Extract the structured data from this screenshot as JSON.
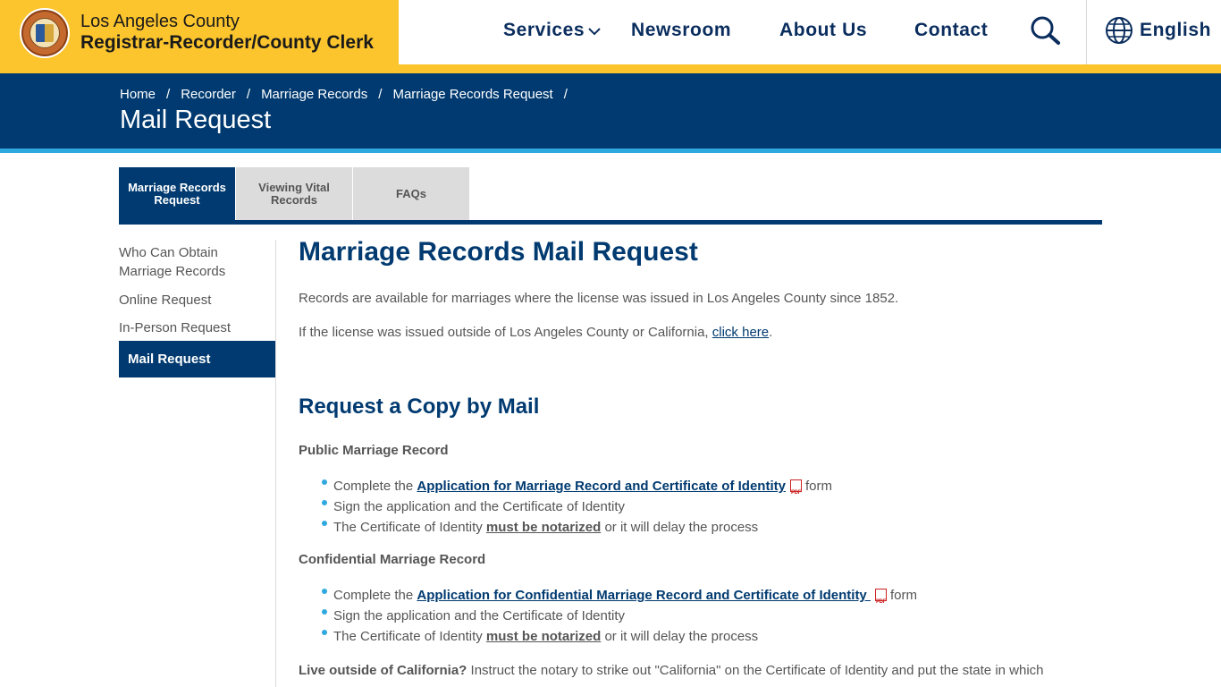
{
  "header": {
    "brand_line1": "Los Angeles County",
    "brand_line2": "Registrar-Recorder/County Clerk",
    "nav": {
      "services": "Services",
      "newsroom": "Newsroom",
      "about": "About Us",
      "contact": "Contact"
    },
    "language": "English",
    "icons": {
      "seal": "county-seal",
      "chevron": "chevron-down-icon",
      "search": "search-icon",
      "globe": "globe-icon"
    }
  },
  "banner": {
    "breadcrumb": [
      "Home",
      "Recorder",
      "Marriage Records",
      "Marriage Records Request"
    ],
    "separator": "/",
    "title": "Mail Request"
  },
  "tabs": [
    {
      "label": "Marriage Records Request",
      "active": true
    },
    {
      "label": "Viewing Vital Records",
      "active": false
    },
    {
      "label": "FAQs",
      "active": false
    }
  ],
  "sidenav": {
    "items": [
      "Who Can Obtain Marriage Records",
      "Online Request",
      "In-Person Request",
      "Mail Request"
    ],
    "active_index": 3
  },
  "content": {
    "heading": "Marriage Records Mail Request",
    "para1": "Records are available for marriages where the license was issued in Los Angeles County since 1852.",
    "para2_prefix": "If the license was issued outside of Los Angeles County or California, ",
    "para2_link": "click here",
    "para2_suffix": ".",
    "section_heading": "Request a Copy by Mail",
    "public": {
      "title": "Public Marriage Record",
      "b1_prefix": "Complete the ",
      "b1_link": "Application for Marriage Record and Certificate of Identity",
      "b1_suffix": "form",
      "b2": "Sign the application and the Certificate of Identity",
      "b3_prefix": "The Certificate of Identity ",
      "b3_link": "must be notarized",
      "b3_suffix": " or it will delay the process"
    },
    "confidential": {
      "title": "Confidential Marriage Record",
      "b1_prefix": "Complete the ",
      "b1_link": "Application for Confidential Marriage Record and Certificate of Identity ",
      "b1_suffix": "form",
      "b2": "Sign the application and the Certificate of Identity",
      "b3_prefix": "The Certificate of Identity ",
      "b3_link": "must be notarized",
      "b3_suffix": " or it will delay the process"
    },
    "live_outside_bold": "Live outside of California?",
    "live_outside_text": " Instruct the notary to strike out \"California\" on the Certificate of Identity and put the state in which"
  },
  "colors": {
    "brand_yellow": "#fcc52e",
    "navy": "#003a70",
    "accent_blue": "#2fa8df",
    "tab_gray": "#dcdcdc",
    "text_gray": "#555555"
  }
}
